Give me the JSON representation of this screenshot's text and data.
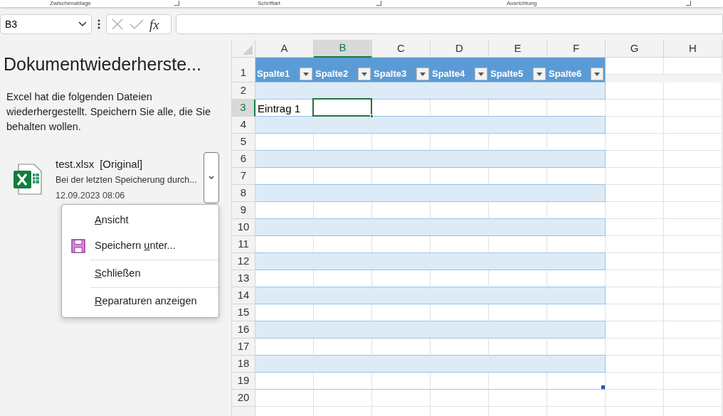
{
  "ribbon_groups": [
    {
      "label": "Zwischenablage"
    },
    {
      "label": "Schriftart"
    },
    {
      "label": "Ausrichtung"
    }
  ],
  "name_box": {
    "value": "B3"
  },
  "formula_bar": {
    "function_label": "fx"
  },
  "recovery_pane": {
    "title": "Dokumentwiederherste...",
    "message": "Excel hat die folgenden Dateien wiederhergestellt. Speichern Sie alle, die Sie behalten wollen.",
    "files": [
      {
        "name": "test.xlsx",
        "tag": "[Original]",
        "description": "Bei der letzten Speicherung durch...",
        "date": "12.09.2023 08:06",
        "menu_open": true
      }
    ],
    "context_menu": [
      {
        "key": "A",
        "after": "nsicht",
        "kind": "plain",
        "separator_before": false
      },
      {
        "before": "Speichern ",
        "key": "u",
        "after": "nter...",
        "kind": "save",
        "separator_before": false
      },
      {
        "key": "S",
        "after": "chließen",
        "kind": "plain",
        "separator_before": true
      },
      {
        "key": "R",
        "after": "eparaturen anzeigen",
        "kind": "plain",
        "separator_before": true
      }
    ]
  },
  "sheet": {
    "columns": [
      {
        "label": "A",
        "selected": false
      },
      {
        "label": "B",
        "selected": true
      },
      {
        "label": "C",
        "selected": false
      },
      {
        "label": "D",
        "selected": false
      },
      {
        "label": "E",
        "selected": false
      },
      {
        "label": "F",
        "selected": false
      },
      {
        "label": "G",
        "selected": false
      },
      {
        "label": "H",
        "selected": false
      }
    ],
    "rows": [
      {
        "label": "1",
        "selected": false
      },
      {
        "label": "2",
        "selected": false
      },
      {
        "label": "3",
        "selected": true
      },
      {
        "label": "4",
        "selected": false
      },
      {
        "label": "5",
        "selected": false
      },
      {
        "label": "6",
        "selected": false
      },
      {
        "label": "7",
        "selected": false
      },
      {
        "label": "8",
        "selected": false
      },
      {
        "label": "9",
        "selected": false
      },
      {
        "label": "10",
        "selected": false
      },
      {
        "label": "11",
        "selected": false
      },
      {
        "label": "12",
        "selected": false
      },
      {
        "label": "13",
        "selected": false
      },
      {
        "label": "14",
        "selected": false
      },
      {
        "label": "15",
        "selected": false
      },
      {
        "label": "16",
        "selected": false
      },
      {
        "label": "17",
        "selected": false
      },
      {
        "label": "18",
        "selected": false
      },
      {
        "label": "19",
        "selected": false
      },
      {
        "label": "20",
        "selected": false
      }
    ],
    "table": {
      "headers": [
        "Spalte1",
        "Spalte2",
        "Spalte3",
        "Spalte4",
        "Spalte5",
        "Spalte6"
      ],
      "body_rows": [
        {
          "banded": true
        },
        {
          "banded": false,
          "cells": [
            {
              "text": "Eintrag 1",
              "selected": false
            },
            {
              "selected": true
            }
          ]
        },
        {
          "banded": true
        },
        {
          "banded": false
        },
        {
          "banded": true
        },
        {
          "banded": false
        },
        {
          "banded": true
        },
        {
          "banded": false
        },
        {
          "banded": true
        },
        {
          "banded": false
        },
        {
          "banded": true
        },
        {
          "banded": false
        },
        {
          "banded": true
        },
        {
          "banded": false
        },
        {
          "banded": true
        },
        {
          "banded": false
        },
        {
          "banded": true
        },
        {
          "banded": false
        }
      ]
    }
  }
}
